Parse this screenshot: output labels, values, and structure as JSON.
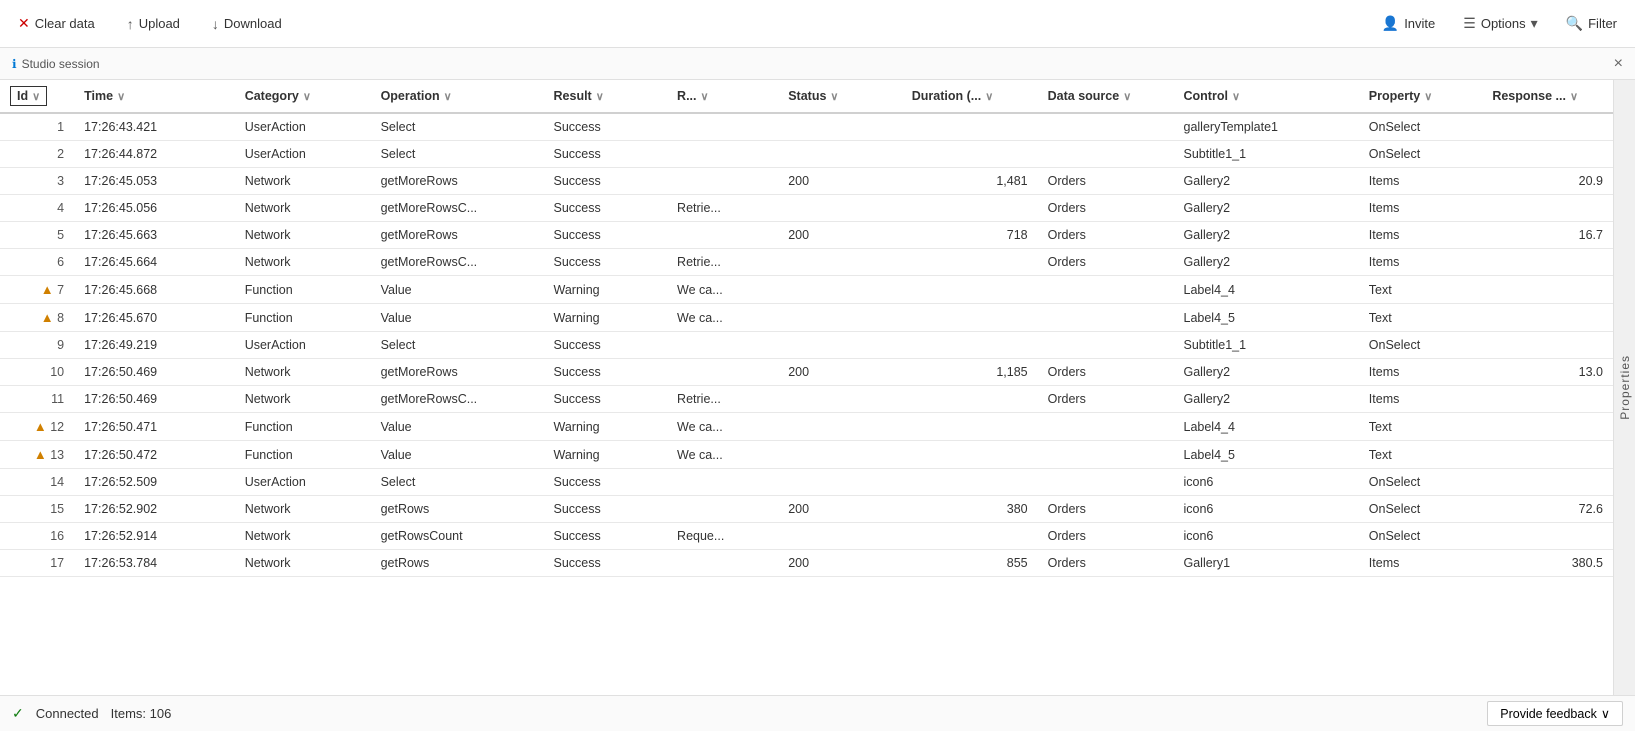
{
  "topbar": {
    "clear_label": "Clear data",
    "upload_label": "Upload",
    "download_label": "Download",
    "invite_label": "Invite",
    "options_label": "Options",
    "filter_label": "Filter"
  },
  "session": {
    "label": "Studio session",
    "close_label": "×"
  },
  "columns": [
    {
      "key": "id",
      "label": "Id"
    },
    {
      "key": "time",
      "label": "Time"
    },
    {
      "key": "category",
      "label": "Category"
    },
    {
      "key": "operation",
      "label": "Operation"
    },
    {
      "key": "result",
      "label": "Result"
    },
    {
      "key": "r",
      "label": "R..."
    },
    {
      "key": "status",
      "label": "Status"
    },
    {
      "key": "duration",
      "label": "Duration (..."
    },
    {
      "key": "datasource",
      "label": "Data source"
    },
    {
      "key": "control",
      "label": "Control"
    },
    {
      "key": "property",
      "label": "Property"
    },
    {
      "key": "response",
      "label": "Response ..."
    }
  ],
  "rows": [
    {
      "id": 1,
      "time": "17:26:43.421",
      "category": "UserAction",
      "operation": "Select",
      "result": "Success",
      "r": "",
      "status": "",
      "duration": "",
      "datasource": "",
      "control": "galleryTemplate1",
      "property": "OnSelect",
      "response": "",
      "warning": false
    },
    {
      "id": 2,
      "time": "17:26:44.872",
      "category": "UserAction",
      "operation": "Select",
      "result": "Success",
      "r": "",
      "status": "",
      "duration": "",
      "datasource": "",
      "control": "Subtitle1_1",
      "property": "OnSelect",
      "response": "",
      "warning": false
    },
    {
      "id": 3,
      "time": "17:26:45.053",
      "category": "Network",
      "operation": "getMoreRows",
      "result": "Success",
      "r": "",
      "status": "200",
      "duration": "1,481",
      "datasource": "Orders",
      "control": "Gallery2",
      "property": "Items",
      "response": "20.9",
      "warning": false
    },
    {
      "id": 4,
      "time": "17:26:45.056",
      "category": "Network",
      "operation": "getMoreRowsC...",
      "result": "Success",
      "r": "Retrie...",
      "status": "",
      "duration": "",
      "datasource": "Orders",
      "control": "Gallery2",
      "property": "Items",
      "response": "",
      "warning": false
    },
    {
      "id": 5,
      "time": "17:26:45.663",
      "category": "Network",
      "operation": "getMoreRows",
      "result": "Success",
      "r": "",
      "status": "200",
      "duration": "718",
      "datasource": "Orders",
      "control": "Gallery2",
      "property": "Items",
      "response": "16.7",
      "warning": false
    },
    {
      "id": 6,
      "time": "17:26:45.664",
      "category": "Network",
      "operation": "getMoreRowsC...",
      "result": "Success",
      "r": "Retrie...",
      "status": "",
      "duration": "",
      "datasource": "Orders",
      "control": "Gallery2",
      "property": "Items",
      "response": "",
      "warning": false
    },
    {
      "id": 7,
      "time": "17:26:45.668",
      "category": "Function",
      "operation": "Value",
      "result": "Warning",
      "r": "We ca...",
      "status": "",
      "duration": "",
      "datasource": "",
      "control": "Label4_4",
      "property": "Text",
      "response": "",
      "warning": true
    },
    {
      "id": 8,
      "time": "17:26:45.670",
      "category": "Function",
      "operation": "Value",
      "result": "Warning",
      "r": "We ca...",
      "status": "",
      "duration": "",
      "datasource": "",
      "control": "Label4_5",
      "property": "Text",
      "response": "",
      "warning": true
    },
    {
      "id": 9,
      "time": "17:26:49.219",
      "category": "UserAction",
      "operation": "Select",
      "result": "Success",
      "r": "",
      "status": "",
      "duration": "",
      "datasource": "",
      "control": "Subtitle1_1",
      "property": "OnSelect",
      "response": "",
      "warning": false
    },
    {
      "id": 10,
      "time": "17:26:50.469",
      "category": "Network",
      "operation": "getMoreRows",
      "result": "Success",
      "r": "",
      "status": "200",
      "duration": "1,185",
      "datasource": "Orders",
      "control": "Gallery2",
      "property": "Items",
      "response": "13.0",
      "warning": false
    },
    {
      "id": 11,
      "time": "17:26:50.469",
      "category": "Network",
      "operation": "getMoreRowsC...",
      "result": "Success",
      "r": "Retrie...",
      "status": "",
      "duration": "",
      "datasource": "Orders",
      "control": "Gallery2",
      "property": "Items",
      "response": "",
      "warning": false
    },
    {
      "id": 12,
      "time": "17:26:50.471",
      "category": "Function",
      "operation": "Value",
      "result": "Warning",
      "r": "We ca...",
      "status": "",
      "duration": "",
      "datasource": "",
      "control": "Label4_4",
      "property": "Text",
      "response": "",
      "warning": true
    },
    {
      "id": 13,
      "time": "17:26:50.472",
      "category": "Function",
      "operation": "Value",
      "result": "Warning",
      "r": "We ca...",
      "status": "",
      "duration": "",
      "datasource": "",
      "control": "Label4_5",
      "property": "Text",
      "response": "",
      "warning": true
    },
    {
      "id": 14,
      "time": "17:26:52.509",
      "category": "UserAction",
      "operation": "Select",
      "result": "Success",
      "r": "",
      "status": "",
      "duration": "",
      "datasource": "",
      "control": "icon6",
      "property": "OnSelect",
      "response": "",
      "warning": false
    },
    {
      "id": 15,
      "time": "17:26:52.902",
      "category": "Network",
      "operation": "getRows",
      "result": "Success",
      "r": "",
      "status": "200",
      "duration": "380",
      "datasource": "Orders",
      "control": "icon6",
      "property": "OnSelect",
      "response": "72.6",
      "warning": false
    },
    {
      "id": 16,
      "time": "17:26:52.914",
      "category": "Network",
      "operation": "getRowsCount",
      "result": "Success",
      "r": "Reque...",
      "status": "",
      "duration": "",
      "datasource": "Orders",
      "control": "icon6",
      "property": "OnSelect",
      "response": "",
      "warning": false
    },
    {
      "id": 17,
      "time": "17:26:53.784",
      "category": "Network",
      "operation": "getRows",
      "result": "Success",
      "r": "",
      "status": "200",
      "duration": "855",
      "datasource": "Orders",
      "control": "Gallery1",
      "property": "Items",
      "response": "380.5",
      "warning": false
    }
  ],
  "side_panel": {
    "label": "Properties"
  },
  "statusbar": {
    "connected_label": "Connected",
    "items_label": "Items: 106",
    "feedback_label": "Provide feedback"
  }
}
